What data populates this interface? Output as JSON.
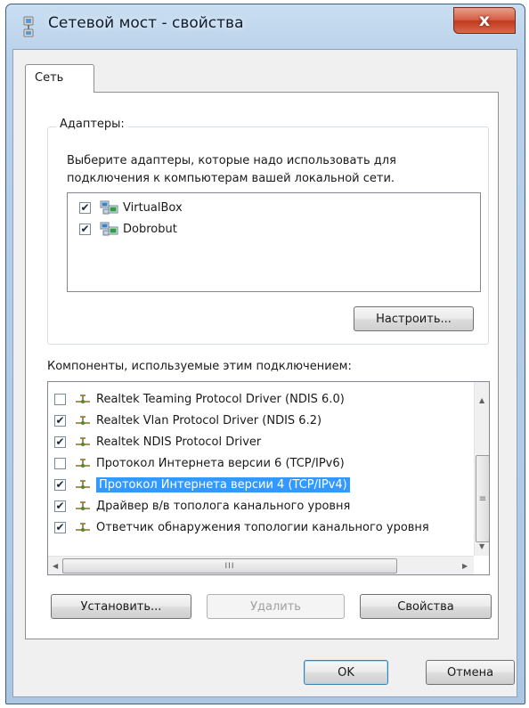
{
  "window": {
    "title": "Сетевой мост - свойства",
    "close_label": "x"
  },
  "tabs": [
    {
      "label": "Сеть",
      "selected": true
    }
  ],
  "adapters": {
    "group_label": "Адаптеры:",
    "description": "Выберите адаптеры, которые надо использовать для подключения к компьютерам вашей локальной сети.",
    "items": [
      {
        "label": "VirtualBox",
        "checked": true,
        "icon": "network-adapter-icon"
      },
      {
        "label": "Dobrobut",
        "checked": true,
        "icon": "network-adapter-icon"
      }
    ],
    "configure_button": "Настроить..."
  },
  "components": {
    "label": "Компоненты, используемые этим подключением:",
    "items": [
      {
        "label": "Realtek Teaming Protocol Driver (NDIS 6.0)",
        "checked": false,
        "icon": "protocol-icon"
      },
      {
        "label": "Realtek Vlan Protocol Driver (NDIS 6.2)",
        "checked": true,
        "icon": "protocol-icon"
      },
      {
        "label": "Realtek NDIS Protocol Driver",
        "checked": true,
        "icon": "protocol-icon"
      },
      {
        "label": "Протокол Интернета версии 6 (TCP/IPv6)",
        "checked": false,
        "icon": "protocol-icon"
      },
      {
        "label": "Протокол Интернета версии 4 (TCP/IPv4)",
        "checked": true,
        "selected": true,
        "icon": "protocol-icon"
      },
      {
        "label": "Драйвер в/в тополога канального уровня",
        "checked": true,
        "icon": "protocol-icon"
      },
      {
        "label": "Ответчик обнаружения топологии канального уровня",
        "checked": true,
        "icon": "protocol-icon"
      }
    ],
    "scroll_thumb_mark": "≡",
    "hscroll_thumb_mark": "III"
  },
  "buttons": {
    "install": "Установить...",
    "remove": "Удалить",
    "properties": "Свойства",
    "ok": "OK",
    "cancel": "Отмена"
  },
  "colors": {
    "selection": "#3399ff",
    "close_button": "#c9452a",
    "title_bar": "#b9d1ea"
  }
}
